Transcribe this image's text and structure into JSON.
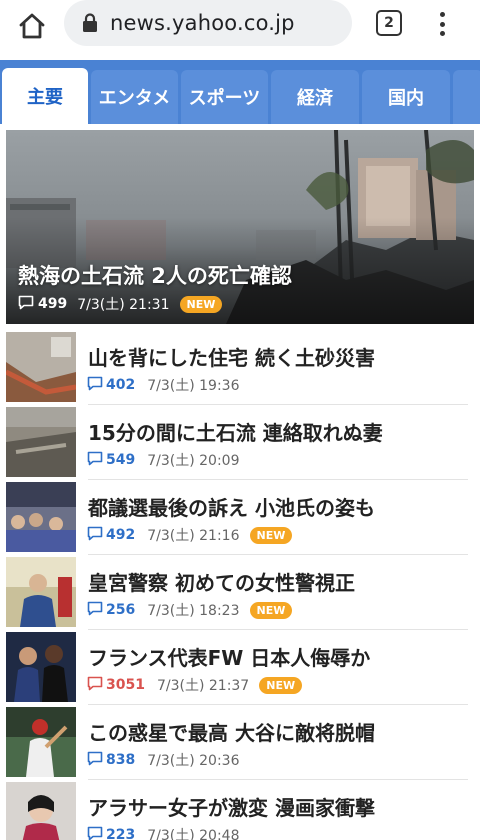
{
  "browser": {
    "url": "news.yahoo.co.jp",
    "tab_count": "2"
  },
  "tabs": [
    {
      "label": "主要",
      "active": true
    },
    {
      "label": "エンタメ",
      "active": false
    },
    {
      "label": "スポーツ",
      "active": false
    },
    {
      "label": "経済",
      "active": false
    },
    {
      "label": "国内",
      "active": false
    }
  ],
  "hero": {
    "title": "熱海の土石流 2人の死亡確認",
    "comments": "499",
    "time": "7/3(土) 21:31",
    "badge": "NEW"
  },
  "articles": [
    {
      "title": "山を背にした住宅 続く土砂災害",
      "comments": "402",
      "time": "7/3(土) 19:36",
      "badge": ""
    },
    {
      "title": "15分の間に土石流 連絡取れぬ妻",
      "comments": "549",
      "time": "7/3(土) 20:09",
      "badge": ""
    },
    {
      "title": "都議選最後の訴え 小池氏の姿も",
      "comments": "492",
      "time": "7/3(土) 21:16",
      "badge": "NEW"
    },
    {
      "title": "皇宮警察 初めての女性警視正",
      "comments": "256",
      "time": "7/3(土) 18:23",
      "badge": "NEW"
    },
    {
      "title": "フランス代表FW 日本人侮辱か",
      "comments": "3051",
      "time": "7/3(土) 21:37",
      "badge": "NEW"
    },
    {
      "title": "この惑星で最高 大谷に敵将脱帽",
      "comments": "838",
      "time": "7/3(土) 20:36",
      "badge": ""
    },
    {
      "title": "アラサー女子が激変 漫画家衝撃",
      "comments": "223",
      "time": "7/3(土) 20:48",
      "badge": ""
    }
  ],
  "colors": {
    "accent": "#4a82d3",
    "comment_blue": "#2e6fc7",
    "comment_hot": "#d9534f",
    "new_badge": "#f5a623"
  }
}
